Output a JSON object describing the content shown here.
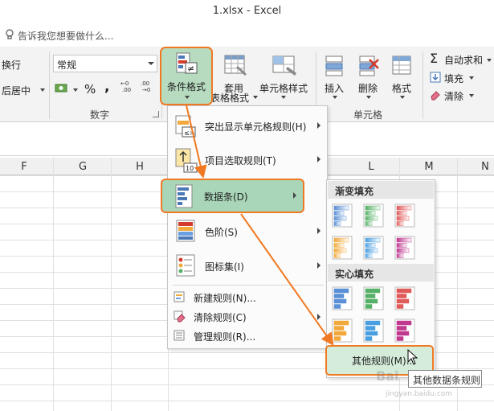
{
  "window": {
    "title": "1.xlsx - Excel"
  },
  "tellme": {
    "placeholder": "告诉我您想要做什么..."
  },
  "ribbon": {
    "wrap_text": "换行",
    "merge_center": "后居中",
    "number_format": "常规",
    "percent": "%",
    "comma": ",",
    "number_group": "数字",
    "conditional_format": "条件格式",
    "table_format_1": "套用",
    "table_format_2": "表格格式",
    "cell_styles": "单元格样式",
    "insert": "插入",
    "delete": "删除",
    "format": "格式",
    "cells_group": "单元格",
    "autosum": "自动求和",
    "fill": "填充",
    "clear": "清除"
  },
  "columns": [
    "F",
    "G",
    "H",
    "L",
    "M",
    "N"
  ],
  "menu": {
    "items": [
      {
        "label": "突出显示单元格规则(H)",
        "icon": "highlight-rules-icon"
      },
      {
        "label": "项目选取规则(T)",
        "icon": "top-bottom-rules-icon"
      },
      {
        "label": "数据条(D)",
        "icon": "data-bars-icon"
      },
      {
        "label": "色阶(S)",
        "icon": "color-scales-icon"
      },
      {
        "label": "图标集(I)",
        "icon": "icon-sets-icon"
      },
      {
        "label": "新建规则(N)...",
        "icon": "new-rule-icon"
      },
      {
        "label": "清除规则(C)",
        "icon": "clear-rules-icon"
      },
      {
        "label": "管理规则(R)...",
        "icon": "manage-rules-icon"
      }
    ]
  },
  "submenu": {
    "gradient_title": "渐变填充",
    "solid_title": "实心填充",
    "more_rules": "其他规则(M)...",
    "bar_colors": [
      "#5b8fd6",
      "#56b067",
      "#e05a5a",
      "#f2a93b",
      "#4a9fe0",
      "#c0398f"
    ]
  },
  "tooltip": {
    "text": "其他数据条规则"
  },
  "watermark": {
    "main": "Bai",
    "sub": "jingyan.baidu.com"
  },
  "colors": {
    "highlight_border": "#f07a23",
    "highlight_fill": "#a9d6b8",
    "ribbon_bg": "#f3f3f3"
  }
}
